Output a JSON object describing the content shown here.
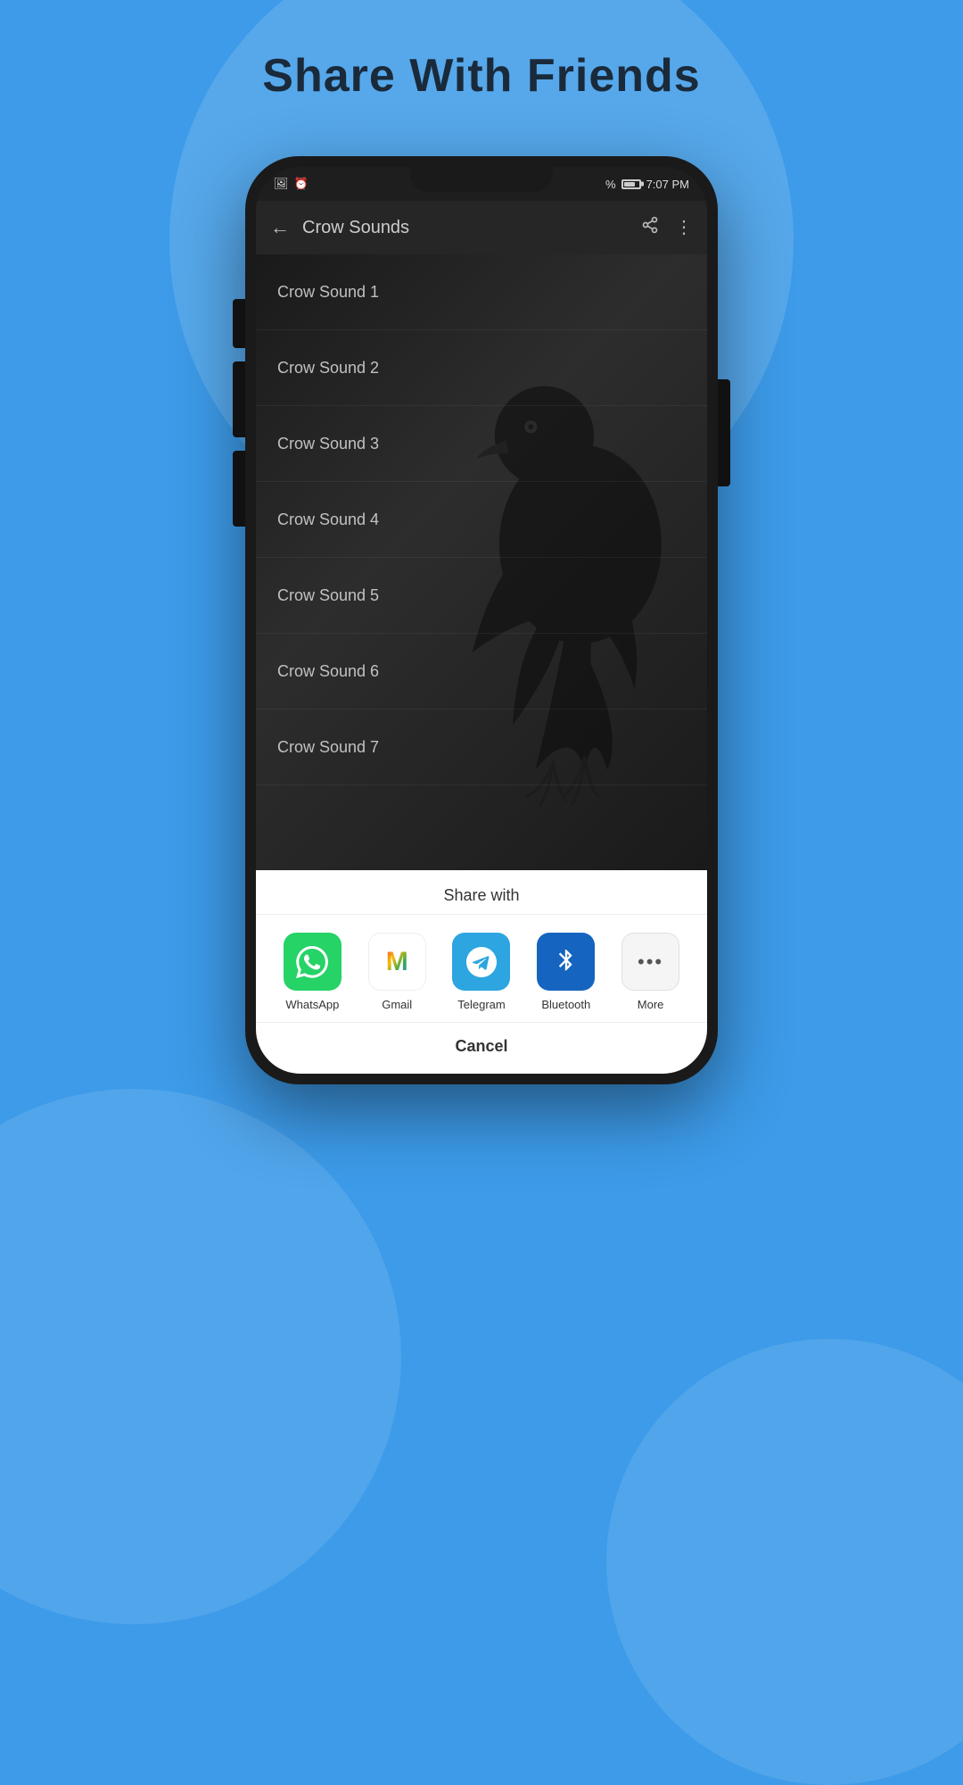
{
  "page": {
    "title": "Share With Friends",
    "background_color": "#3d9be9"
  },
  "status_bar": {
    "time": "7:07 PM",
    "battery_percent": "%",
    "signal": "●●●"
  },
  "app_bar": {
    "title": "Crow Sounds",
    "back_label": "←",
    "share_icon": "share",
    "more_icon": "⋮"
  },
  "sound_list": {
    "items": [
      {
        "id": 1,
        "name": "Crow Sound 1"
      },
      {
        "id": 2,
        "name": "Crow Sound 2"
      },
      {
        "id": 3,
        "name": "Crow Sound 3"
      },
      {
        "id": 4,
        "name": "Crow Sound 4"
      },
      {
        "id": 5,
        "name": "Crow Sound 5"
      },
      {
        "id": 6,
        "name": "Crow Sound 6"
      },
      {
        "id": 7,
        "name": "Crow Sound 7"
      }
    ]
  },
  "share_sheet": {
    "title": "Share with",
    "apps": [
      {
        "id": "whatsapp",
        "label": "WhatsApp",
        "icon_type": "whatsapp"
      },
      {
        "id": "gmail",
        "label": "Gmail",
        "icon_type": "gmail"
      },
      {
        "id": "telegram",
        "label": "Telegram",
        "icon_type": "telegram"
      },
      {
        "id": "bluetooth",
        "label": "Bluetooth",
        "icon_type": "bluetooth"
      },
      {
        "id": "more",
        "label": "More",
        "icon_type": "more"
      }
    ],
    "cancel_label": "Cancel"
  }
}
